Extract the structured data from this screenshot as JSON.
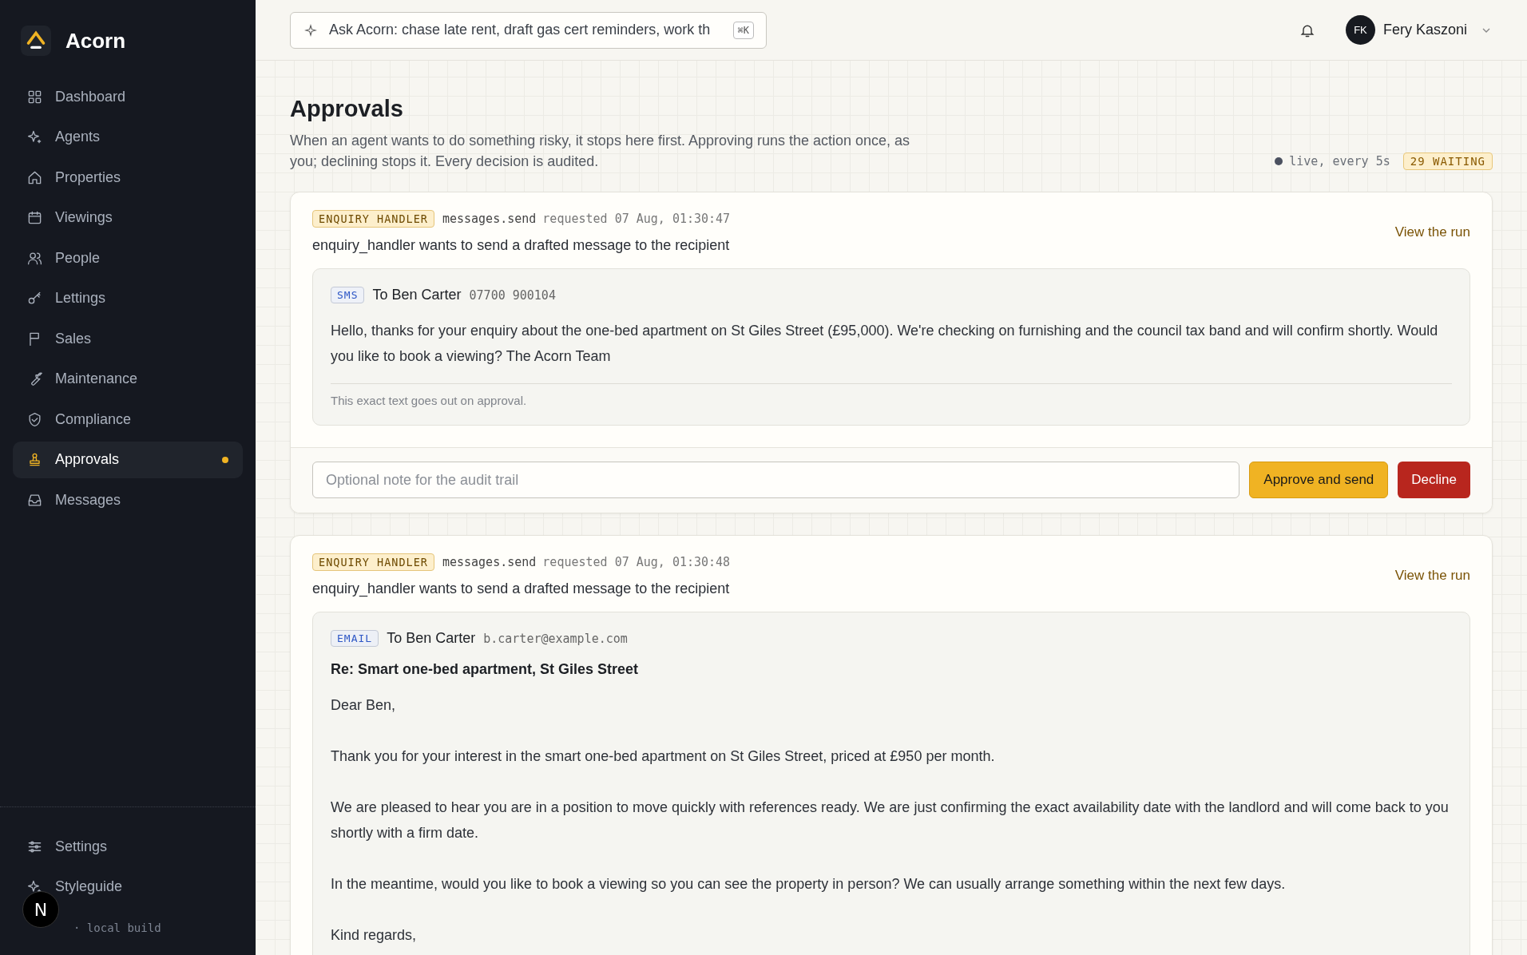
{
  "brand": {
    "name": "Acorn"
  },
  "nav": [
    {
      "label": "Dashboard",
      "selected": false,
      "dot": false
    },
    {
      "label": "Agents",
      "selected": false,
      "dot": false
    },
    {
      "label": "Properties",
      "selected": false,
      "dot": false
    },
    {
      "label": "Viewings",
      "selected": false,
      "dot": false
    },
    {
      "label": "People",
      "selected": false,
      "dot": false
    },
    {
      "label": "Lettings",
      "selected": false,
      "dot": false
    },
    {
      "label": "Sales",
      "selected": false,
      "dot": false
    },
    {
      "label": "Maintenance",
      "selected": false,
      "dot": false
    },
    {
      "label": "Compliance",
      "selected": false,
      "dot": false
    },
    {
      "label": "Approvals",
      "selected": true,
      "dot": true
    },
    {
      "label": "Messages",
      "selected": false,
      "dot": false
    }
  ],
  "footer_nav": [
    {
      "label": "Settings",
      "selected": false
    },
    {
      "label": "Styleguide",
      "selected": false
    }
  ],
  "build": "· local build",
  "dev_badge": "N",
  "search": {
    "placeholder": "Ask Acorn: chase late rent, draft gas cert reminders, work th",
    "shortcut": "⌘K"
  },
  "user": {
    "initials": "FK",
    "name": "Fery Kaszoni"
  },
  "page": {
    "title": "Approvals",
    "description": "When an agent wants to do something risky, it stops here first. Approving runs the action once, as you; declining stops it. Every decision is audited.",
    "live": "live, every 5s",
    "waiting": "29 WAITING"
  },
  "approvals": [
    {
      "agent": "ENQUIRY HANDLER",
      "tool": "messages.send",
      "requested": "requested 07 Aug, 01:30:47",
      "summary": "enquiry_handler wants to send a drafted message to the recipient",
      "link": "View the run",
      "message": {
        "kind": "sms",
        "channel": "SMS",
        "to": "To Ben Carter",
        "address": "07700 900104",
        "paragraphs": [
          "Hello, thanks for your enquiry about the one-bed apartment on St Giles Street (£95,000). We're checking on furnishing and the council tax band and will confirm shortly. Would you like to book a viewing? The Acorn Team"
        ],
        "footnote": "This exact text goes out on approval."
      },
      "note_placeholder": "Optional note for the audit trail",
      "approve": "Approve and send",
      "decline": "Decline"
    },
    {
      "agent": "ENQUIRY HANDLER",
      "tool": "messages.send",
      "requested": "requested 07 Aug, 01:30:48",
      "summary": "enquiry_handler wants to send a drafted message to the recipient",
      "link": "View the run",
      "message": {
        "kind": "email",
        "channel": "EMAIL",
        "to": "To Ben Carter",
        "address": "b.carter@example.com",
        "subject": "Re: Smart one-bed apartment, St Giles Street",
        "paragraphs": [
          "Dear Ben,",
          "Thank you for your interest in the smart one-bed apartment on St Giles Street, priced at £950 per month.",
          "We are pleased to hear you are in a position to move quickly with references ready. We are just confirming the exact availability date with the landlord and will come back to you shortly with a firm date.",
          "In the meantime, would you like to book a viewing so you can see the property in person? We can usually arrange something within the next few days.",
          "Kind regards,"
        ]
      }
    }
  ]
}
